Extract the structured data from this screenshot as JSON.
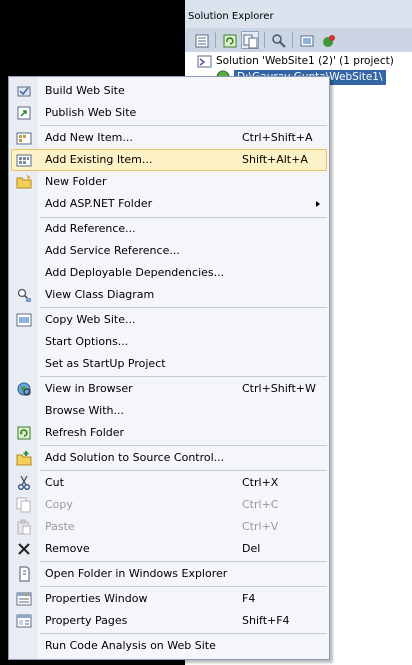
{
  "solution_explorer": {
    "title": "Solution Explorer",
    "toolbar_icons": [
      "properties-icon",
      "refresh-icon",
      "nest-related-files-icon",
      "copy-website-icon",
      "view-class-diagram-icon",
      "aspnet-configuration-icon"
    ],
    "tree": {
      "solution_label": "Solution 'WebSite1 (2)' (1 project)",
      "website_label": "D:\\Gaurav Gupta\\WebSite1\\"
    }
  },
  "context_menu": {
    "items": [
      {
        "icon": "build-icon",
        "label": "Build Web Site",
        "shortcut": ""
      },
      {
        "icon": "publish-icon",
        "label": "Publish Web Site",
        "shortcut": ""
      },
      {
        "icon": "add-new-item-icon",
        "label": "Add New Item...",
        "shortcut": "Ctrl+Shift+A"
      },
      {
        "icon": "add-existing-item-icon",
        "label": "Add Existing Item...",
        "shortcut": "Shift+Alt+A"
      },
      {
        "icon": "new-folder-icon",
        "label": "New Folder",
        "shortcut": ""
      },
      {
        "icon": "",
        "label": "Add ASP.NET Folder",
        "shortcut": ""
      },
      {
        "icon": "",
        "label": "Add Reference...",
        "shortcut": ""
      },
      {
        "icon": "",
        "label": "Add Service Reference...",
        "shortcut": ""
      },
      {
        "icon": "",
        "label": "Add Deployable Dependencies...",
        "shortcut": ""
      },
      {
        "icon": "view-class-diagram-icon",
        "label": "View Class Diagram",
        "shortcut": ""
      },
      {
        "icon": "copy-website-icon",
        "label": "Copy Web Site...",
        "shortcut": ""
      },
      {
        "icon": "",
        "label": "Start Options...",
        "shortcut": ""
      },
      {
        "icon": "",
        "label": "Set as StartUp Project",
        "shortcut": ""
      },
      {
        "icon": "view-in-browser-icon",
        "label": "View in Browser",
        "shortcut": "Ctrl+Shift+W"
      },
      {
        "icon": "",
        "label": "Browse With...",
        "shortcut": ""
      },
      {
        "icon": "refresh-folder-icon",
        "label": "Refresh Folder",
        "shortcut": ""
      },
      {
        "icon": "add-to-source-control-icon",
        "label": "Add Solution to Source Control...",
        "shortcut": ""
      },
      {
        "icon": "cut-icon",
        "label": "Cut",
        "shortcut": "Ctrl+X"
      },
      {
        "icon": "copy-icon",
        "label": "Copy",
        "shortcut": "Ctrl+C"
      },
      {
        "icon": "paste-icon",
        "label": "Paste",
        "shortcut": "Ctrl+V"
      },
      {
        "icon": "remove-icon",
        "label": "Remove",
        "shortcut": "Del"
      },
      {
        "icon": "open-folder-icon",
        "label": "Open Folder in Windows Explorer",
        "shortcut": ""
      },
      {
        "icon": "properties-window-icon",
        "label": "Properties Window",
        "shortcut": "F4"
      },
      {
        "icon": "property-pages-icon",
        "label": "Property Pages",
        "shortcut": "Shift+F4"
      },
      {
        "icon": "",
        "label": "Run Code Analysis on Web Site",
        "shortcut": ""
      }
    ]
  },
  "colors": {
    "menu_bg": "#f5f6fa",
    "menu_gutter": "#e9ecf3",
    "highlight_bg": "#fdf1c6",
    "highlight_border": "#e5c365",
    "selection_bg": "#3465a4",
    "disabled_text": "#9a9a9a"
  }
}
